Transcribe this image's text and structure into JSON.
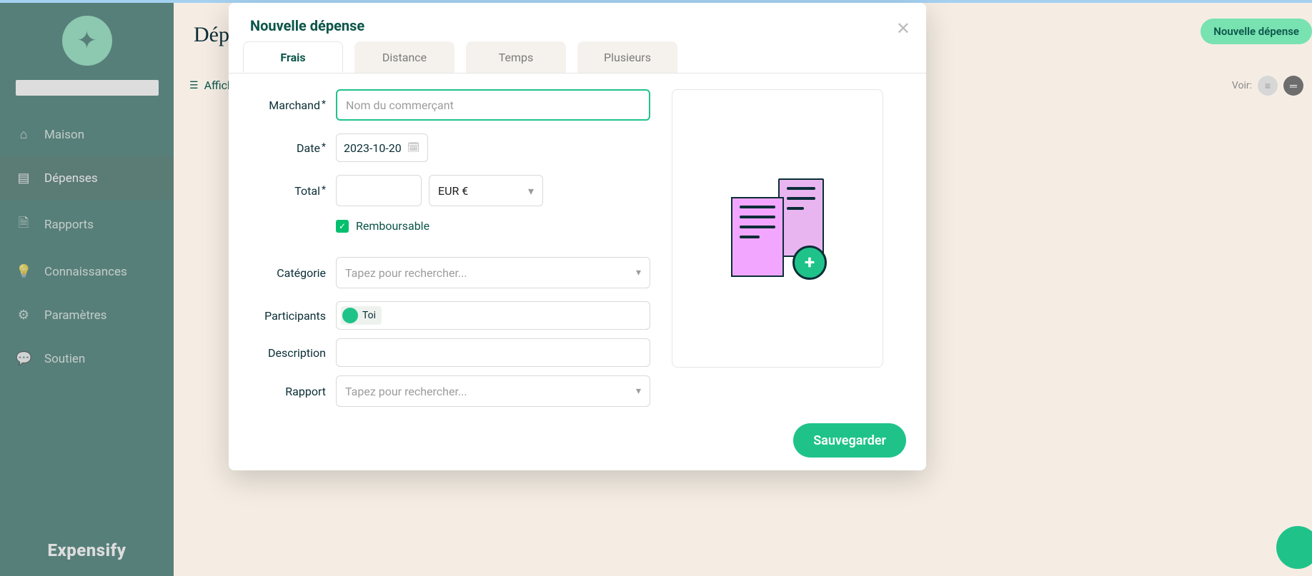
{
  "brand": "Expensify",
  "sidebar": {
    "items": [
      {
        "icon": "⌂",
        "label": "Maison"
      },
      {
        "icon": "▤",
        "label": "Dépenses"
      },
      {
        "icon": "🗎",
        "label": "Rapports"
      },
      {
        "icon": "💡",
        "label": "Connaissances"
      },
      {
        "icon": "⚙",
        "label": "Paramètres"
      },
      {
        "icon": "💬",
        "label": "Soutien"
      }
    ]
  },
  "page": {
    "title": "Dépenses",
    "filter_label": "Afficher les filtres",
    "new_expense_pill": "Nouvelle dépense",
    "view_label": "Voir:"
  },
  "modal": {
    "title": "Nouvelle dépense",
    "tabs": [
      {
        "label": "Frais",
        "active": true
      },
      {
        "label": "Distance"
      },
      {
        "label": "Temps"
      },
      {
        "label": "Plusieurs"
      }
    ],
    "fields": {
      "merchant_label": "Marchand",
      "merchant_placeholder": "Nom du commerçant",
      "date_label": "Date",
      "date_value": "2023-10-20",
      "total_label": "Total",
      "total_value": "",
      "currency_value": "EUR €",
      "reimbursable_label": "Remboursable",
      "reimbursable_checked": true,
      "category_label": "Catégorie",
      "category_placeholder": "Tapez pour rechercher...",
      "participants_label": "Participants",
      "participant_chip": "Toi",
      "description_label": "Description",
      "report_label": "Rapport",
      "report_placeholder": "Tapez pour rechercher..."
    },
    "save_label": "Sauvegarder"
  }
}
